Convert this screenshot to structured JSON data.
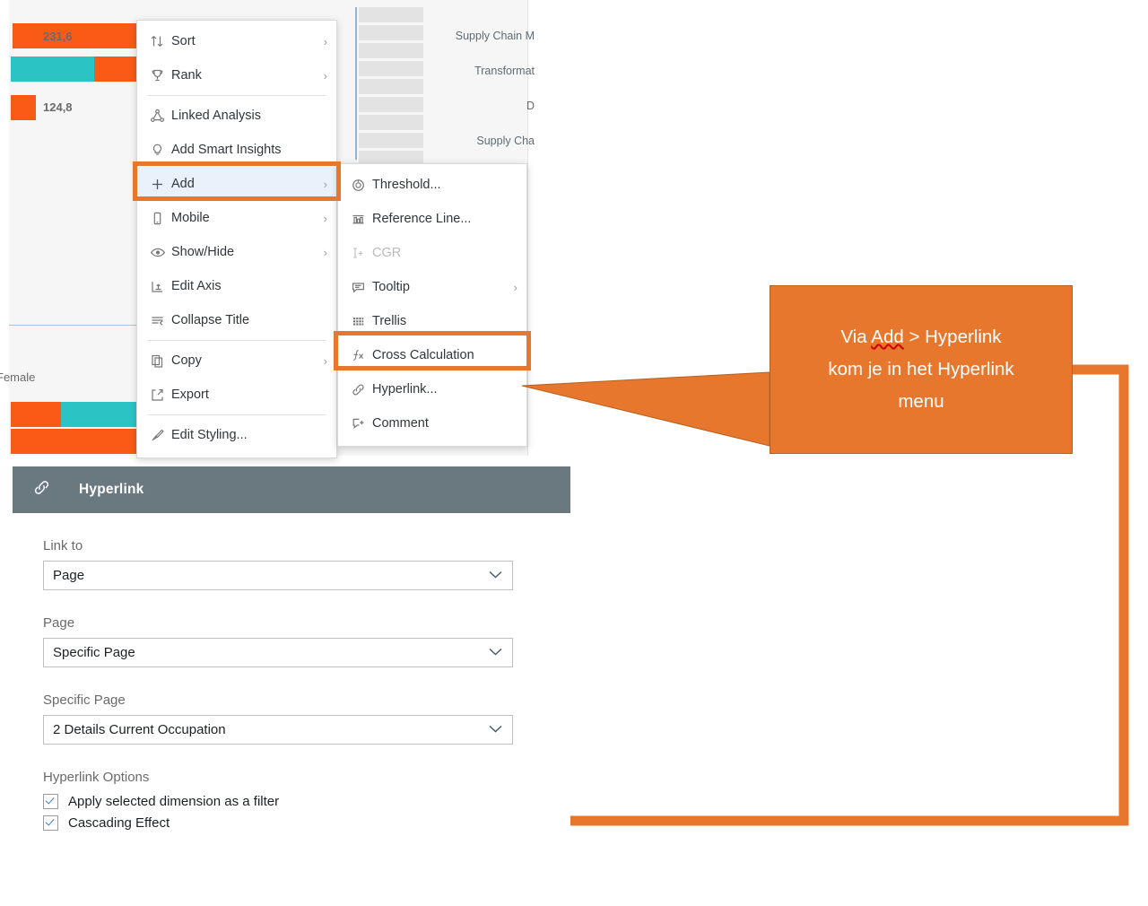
{
  "background_chart": {
    "value_labels": [
      "231,6",
      "124,8"
    ],
    "axis_labels": [
      "Female"
    ],
    "category_labels": [
      "Supply Chain M",
      "Transformat",
      "D",
      "Supply Cha"
    ],
    "colors": {
      "bar_orange": "#f95b16",
      "bar_teal": "#2bc4c4",
      "panel_bg": "#f6f6f6",
      "grey_row": "#e3e3e3",
      "rule_blue": "#a9c3dd"
    }
  },
  "context_menu": {
    "items": [
      {
        "label": "Sort",
        "icon": "sort-icon",
        "glyph": "↑↓",
        "arrow": true,
        "disabled": false
      },
      {
        "label": "Rank",
        "icon": "trophy-icon",
        "glyph": "⚱",
        "arrow": true,
        "disabled": false
      },
      {
        "label": "Linked Analysis",
        "icon": "linked-analysis-icon",
        "glyph": "∴",
        "arrow": false,
        "disabled": false
      },
      {
        "label": "Add Smart Insights",
        "icon": "lightbulb-icon",
        "glyph": "⚲",
        "arrow": false,
        "disabled": false
      },
      {
        "label": "Add",
        "icon": "plus-icon",
        "glyph": "＋",
        "arrow": true,
        "disabled": false
      },
      {
        "label": "Mobile",
        "icon": "mobile-icon",
        "glyph": "☐",
        "arrow": true,
        "disabled": false
      },
      {
        "label": "Show/Hide",
        "icon": "eye-icon",
        "glyph": "◉",
        "arrow": true,
        "disabled": false
      },
      {
        "label": "Edit Axis",
        "icon": "edit-axis-icon",
        "glyph": "⊦",
        "arrow": false,
        "disabled": false
      },
      {
        "label": "Collapse Title",
        "icon": "collapse-title-icon",
        "glyph": "⇥",
        "arrow": false,
        "disabled": false
      },
      {
        "label": "Copy",
        "icon": "copy-icon",
        "glyph": "⧉",
        "arrow": true,
        "disabled": false
      },
      {
        "label": "Export",
        "icon": "export-icon",
        "glyph": "↗",
        "arrow": false,
        "disabled": false
      },
      {
        "label": "Edit Styling...",
        "icon": "brush-icon",
        "glyph": "✎",
        "arrow": false,
        "disabled": false
      }
    ],
    "highlighted_item": "Add"
  },
  "add_submenu": {
    "items": [
      {
        "label": "Threshold...",
        "icon": "threshold-icon",
        "glyph": "◎",
        "arrow": false,
        "disabled": false
      },
      {
        "label": "Reference Line...",
        "icon": "reference-line-icon",
        "glyph": "╨",
        "arrow": false,
        "disabled": false
      },
      {
        "label": "CGR",
        "icon": "cgr-icon",
        "glyph": "†",
        "arrow": false,
        "disabled": true
      },
      {
        "label": "Tooltip",
        "icon": "tooltip-icon",
        "glyph": "⬚",
        "arrow": true,
        "disabled": false
      },
      {
        "label": "Trellis",
        "icon": "trellis-icon",
        "glyph": "▒",
        "arrow": false,
        "disabled": false
      },
      {
        "label": "Cross Calculation",
        "icon": "function-icon",
        "glyph": "ƒx",
        "arrow": false,
        "disabled": false
      },
      {
        "label": "Hyperlink...",
        "icon": "link-icon",
        "glyph": "🔗",
        "arrow": false,
        "disabled": false
      },
      {
        "label": "Comment",
        "icon": "comment-icon",
        "glyph": "⬚",
        "arrow": false,
        "disabled": false
      }
    ],
    "highlighted_item": "Cross Calculation"
  },
  "callout": {
    "line1_prefix": "Via ",
    "line1_spell": "Add",
    "line1_suffix": " > Hyperlink",
    "line2": "kom je in het Hyperlink",
    "line3": "menu",
    "color": "#e8772e"
  },
  "hyperlink_dialog": {
    "icon": "link-icon",
    "title": "Hyperlink",
    "fields": [
      {
        "label": "Link to",
        "value": "Page"
      },
      {
        "label": "Page",
        "value": "Specific Page"
      },
      {
        "label": "Specific Page",
        "value": "2 Details Current Occupation"
      }
    ],
    "options_label": "Hyperlink Options",
    "options": [
      {
        "label": "Apply selected dimension as a filter",
        "checked": true
      },
      {
        "label": "Cascading Effect",
        "checked": true
      }
    ],
    "header_color": "#6a7880"
  },
  "highlight_color": "#e8772e"
}
